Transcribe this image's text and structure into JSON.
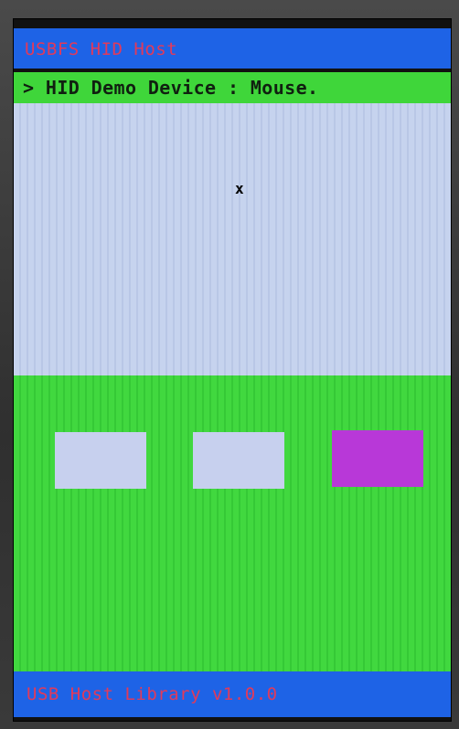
{
  "app": {
    "title": "USBFS HID Host"
  },
  "status": {
    "text": "> HID Demo Device : Mouse."
  },
  "mouse_area": {
    "cursor": "x"
  },
  "buttons": [
    {
      "state": "released"
    },
    {
      "state": "released"
    },
    {
      "state": "pressed"
    }
  ],
  "footer": {
    "text": "USB Host Library v1.0.0"
  },
  "colors": {
    "header": "#1e63e6",
    "status": "#3fd63a",
    "area": "#c6d3ee",
    "button_area": "#41d83f",
    "button_released": "#c7d0ee",
    "button_pressed": "#b838d8",
    "text_accent": "#e23a5a"
  }
}
